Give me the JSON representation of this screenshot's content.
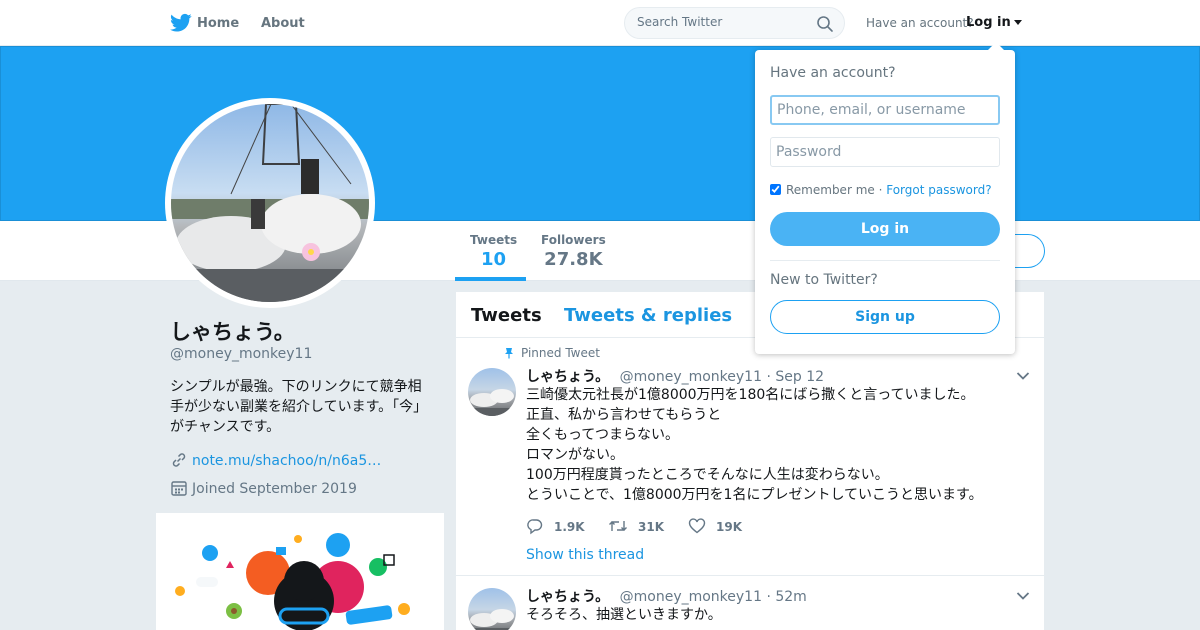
{
  "nav": {
    "home_label": "Home",
    "about_label": "About",
    "search_placeholder": "Search Twitter",
    "have_account": "Have an account?",
    "login_label": "Log in"
  },
  "colors": {
    "brand": "#1da1f2",
    "link": "#1b95e0",
    "login_button": "#4ab3f4"
  },
  "profile": {
    "name": "しゃちょう。",
    "handle": "@money_monkey11",
    "bio": "シンプルが最強。下のリンクにて競争相手が少ない副業を紹介しています。「今」がチャンスです。",
    "link": "note.mu/shachoo/n/n6a5…",
    "joined": "Joined September 2019"
  },
  "stats": [
    {
      "label": "Tweets",
      "value": "10"
    },
    {
      "label": "Followers",
      "value": "27.8K"
    }
  ],
  "timeline": {
    "tabs": [
      "Tweets",
      "Tweets & replies"
    ],
    "tweets": [
      {
        "pinned_label": "Pinned Tweet",
        "name": "しゃちょう。",
        "handle": "@money_monkey11",
        "time": "· Sep 12",
        "lines": [
          "三崎優太元社長が1億8000万円を180名にばら撒くと言っていました。",
          "正直、私から言わせてもらうと",
          "全くもってつまらない。",
          "ロマンがない。",
          "100万円程度貰ったところでそんなに人生は変わらない。",
          "とういことで、1億8000万円を1名にプレゼントしていこうと思います。"
        ],
        "replies": "1.9K",
        "retweets": "31K",
        "likes": "19K",
        "show_thread": "Show this thread"
      },
      {
        "name": "しゃちょう。",
        "handle": "@money_monkey11",
        "time": "· 52m",
        "lines": [
          "そろそろ、抽選といきますか。"
        ]
      }
    ]
  },
  "login_dropdown": {
    "title": "Have an account?",
    "username_placeholder": "Phone, email, or username",
    "password_placeholder": "Password",
    "remember_label": "Remember me",
    "separator": " · ",
    "forgot_label": "Forgot password?",
    "login_button": "Log in",
    "new_to": "New to Twitter?",
    "signup_button": "Sign up"
  }
}
